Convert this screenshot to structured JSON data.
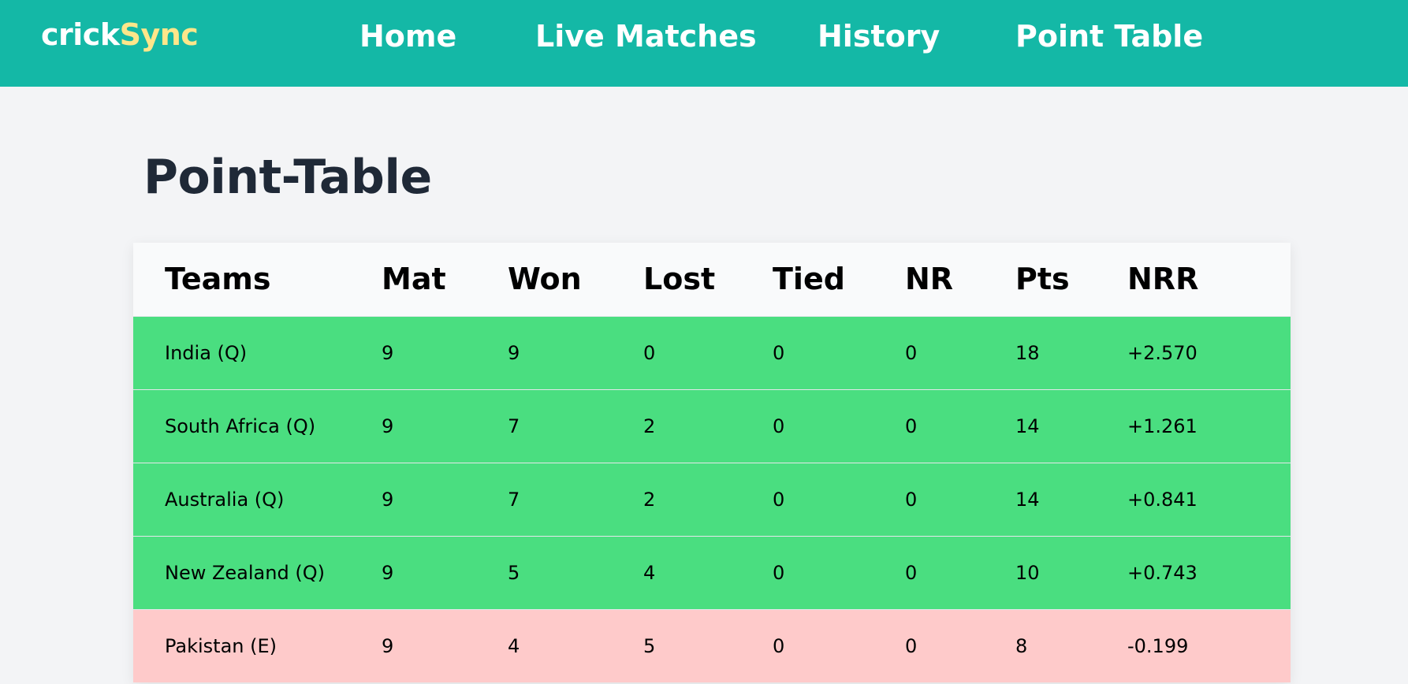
{
  "navbar": {
    "logo_main": "crick",
    "logo_accent": "Sync",
    "links": [
      "Home",
      "Live Matches",
      "History",
      "Point Table"
    ]
  },
  "page": {
    "title": "Point-Table"
  },
  "table": {
    "headers": [
      "Teams",
      "Mat",
      "Won",
      "Lost",
      "Tied",
      "NR",
      "Pts",
      "NRR"
    ],
    "rows": [
      {
        "team": "India (Q)",
        "mat": "9",
        "won": "9",
        "lost": "0",
        "tied": "0",
        "nr": "0",
        "pts": "18",
        "nrr": "+2.570",
        "status": "qualified"
      },
      {
        "team": "South Africa (Q)",
        "mat": "9",
        "won": "7",
        "lost": "2",
        "tied": "0",
        "nr": "0",
        "pts": "14",
        "nrr": "+1.261",
        "status": "qualified"
      },
      {
        "team": "Australia (Q)",
        "mat": "9",
        "won": "7",
        "lost": "2",
        "tied": "0",
        "nr": "0",
        "pts": "14",
        "nrr": "+0.841",
        "status": "qualified"
      },
      {
        "team": "New Zealand (Q)",
        "mat": "9",
        "won": "5",
        "lost": "4",
        "tied": "0",
        "nr": "0",
        "pts": "10",
        "nrr": "+0.743",
        "status": "qualified"
      },
      {
        "team": "Pakistan (E)",
        "mat": "9",
        "won": "4",
        "lost": "5",
        "tied": "0",
        "nr": "0",
        "pts": "8",
        "nrr": "-0.199",
        "status": "eliminated"
      }
    ]
  },
  "colors": {
    "navbar": "#14b8a6",
    "logo_accent": "#fde68a",
    "qualified_row": "#4ade80",
    "eliminated_row": "#fecaca",
    "title": "#1f2937"
  }
}
